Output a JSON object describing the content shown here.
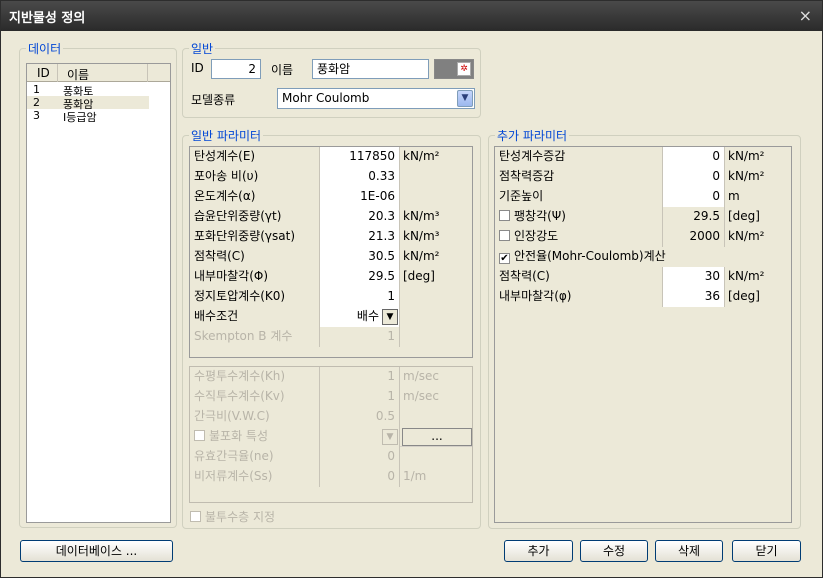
{
  "window": {
    "title": "지반물성 정의",
    "close_glyph": "×"
  },
  "data_panel": {
    "legend": "데이터",
    "col_id": "ID",
    "col_name": "이름",
    "rows": [
      {
        "id": "1",
        "name": "풍화토"
      },
      {
        "id": "2",
        "name": "풍화암"
      },
      {
        "id": "3",
        "name": "I등급암"
      }
    ]
  },
  "general": {
    "legend": "일반",
    "id_label": "ID",
    "id_value": "2",
    "name_label": "이름",
    "name_value": "풍화암",
    "model_label": "모델종류",
    "model_value": "Mohr Coulomb"
  },
  "params": {
    "legend": "일반 파라미터",
    "rows": [
      {
        "label": "탄성계수(E)",
        "value": "117850",
        "unit": "kN/m²"
      },
      {
        "label": "포아송 비(υ)",
        "value": "0.33",
        "unit": ""
      },
      {
        "label": "온도계수(α)",
        "value": "1E-06",
        "unit": ""
      },
      {
        "label": "습윤단위중량(γt)",
        "value": "20.3",
        "unit": "kN/m³"
      },
      {
        "label": "포화단위중량(γsat)",
        "value": "21.3",
        "unit": "kN/m³"
      },
      {
        "label": "점착력(C)",
        "value": "30.5",
        "unit": "kN/m²"
      },
      {
        "label": "내부마찰각(Φ)",
        "value": "29.5",
        "unit": "[deg]"
      },
      {
        "label": "정지토압계수(K0)",
        "value": "1",
        "unit": ""
      }
    ],
    "drainage_label": "배수조건",
    "drainage_value": "배수",
    "skempton_label": "Skempton B 계수",
    "skempton_value": "1"
  },
  "perm": {
    "rows": [
      {
        "label": "수평투수계수(Kh)",
        "value": "1",
        "unit": "m/sec"
      },
      {
        "label": "수직투수계수(Kv)",
        "value": "1",
        "unit": "m/sec"
      },
      {
        "label": "간극비(V.W.C)",
        "value": "0.5",
        "unit": ""
      },
      {
        "label": "불포화 특성",
        "value": "",
        "unit": "..."
      },
      {
        "label": "유효간극율(ne)",
        "value": "0",
        "unit": ""
      },
      {
        "label": "비저류계수(Ss)",
        "value": "0",
        "unit": "1/m"
      }
    ],
    "impermeable_label": "불투수층 지정"
  },
  "extra": {
    "legend": "추가 파라미터",
    "rows": [
      {
        "label": "탄성계수증감",
        "value": "0",
        "unit": "kN/m²"
      },
      {
        "label": "점착력증감",
        "value": "0",
        "unit": "kN/m²"
      },
      {
        "label": "기준높이",
        "value": "0",
        "unit": "m"
      },
      {
        "label": "팽창각(Ψ)",
        "value": "29.5",
        "unit": "[deg]"
      },
      {
        "label": "인장강도",
        "value": "2000",
        "unit": "kN/m²"
      }
    ],
    "safety_label": "안전율(Mohr-Coulomb)계산",
    "rows2": [
      {
        "label": "점착력(C)",
        "value": "30",
        "unit": "kN/m²"
      },
      {
        "label": "내부마찰각(φ)",
        "value": "36",
        "unit": "[deg]"
      }
    ]
  },
  "buttons": {
    "database": "데이터베이스 ...",
    "add": "추가",
    "modify": "수정",
    "delete": "삭제",
    "close": "닫기"
  }
}
